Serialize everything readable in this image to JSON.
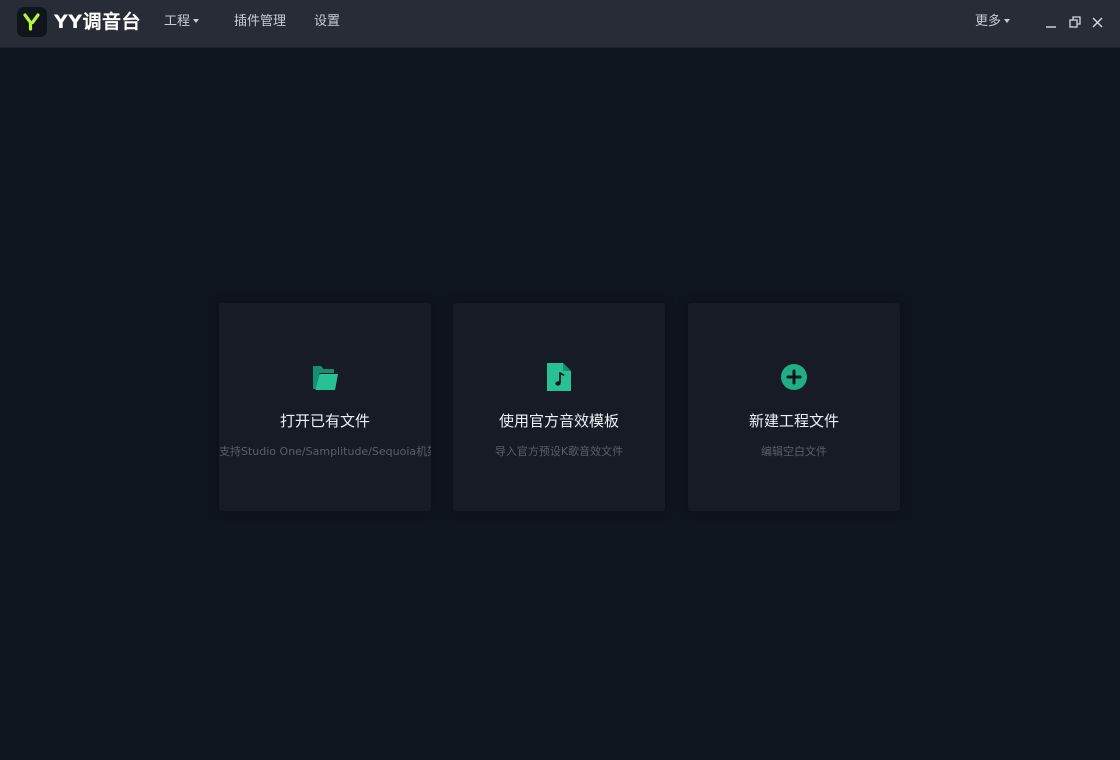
{
  "app": {
    "brand": "YY调音台"
  },
  "menu": {
    "project": "工程",
    "plugins": "插件管理",
    "settings": "设置",
    "more": "更多"
  },
  "window_controls": {
    "minimize": "minimize-icon",
    "restore": "restore-icon",
    "close": "close-icon"
  },
  "cards": [
    {
      "icon": "folder-open-icon",
      "title": "打开已有文件",
      "subtitle": "支持Studio One/Samplitude/Sequoia机架"
    },
    {
      "icon": "music-file-icon",
      "title": "使用官方音效模板",
      "subtitle": "导入官方预设K歌音效文件"
    },
    {
      "icon": "plus-circle-icon",
      "title": "新建工程文件",
      "subtitle": "编辑空白文件"
    }
  ],
  "colors": {
    "background": "#0f151f",
    "titlebar": "#272c36",
    "card": "#161b25",
    "accent": "#1fae86",
    "logo_green": "#b7f23c"
  }
}
